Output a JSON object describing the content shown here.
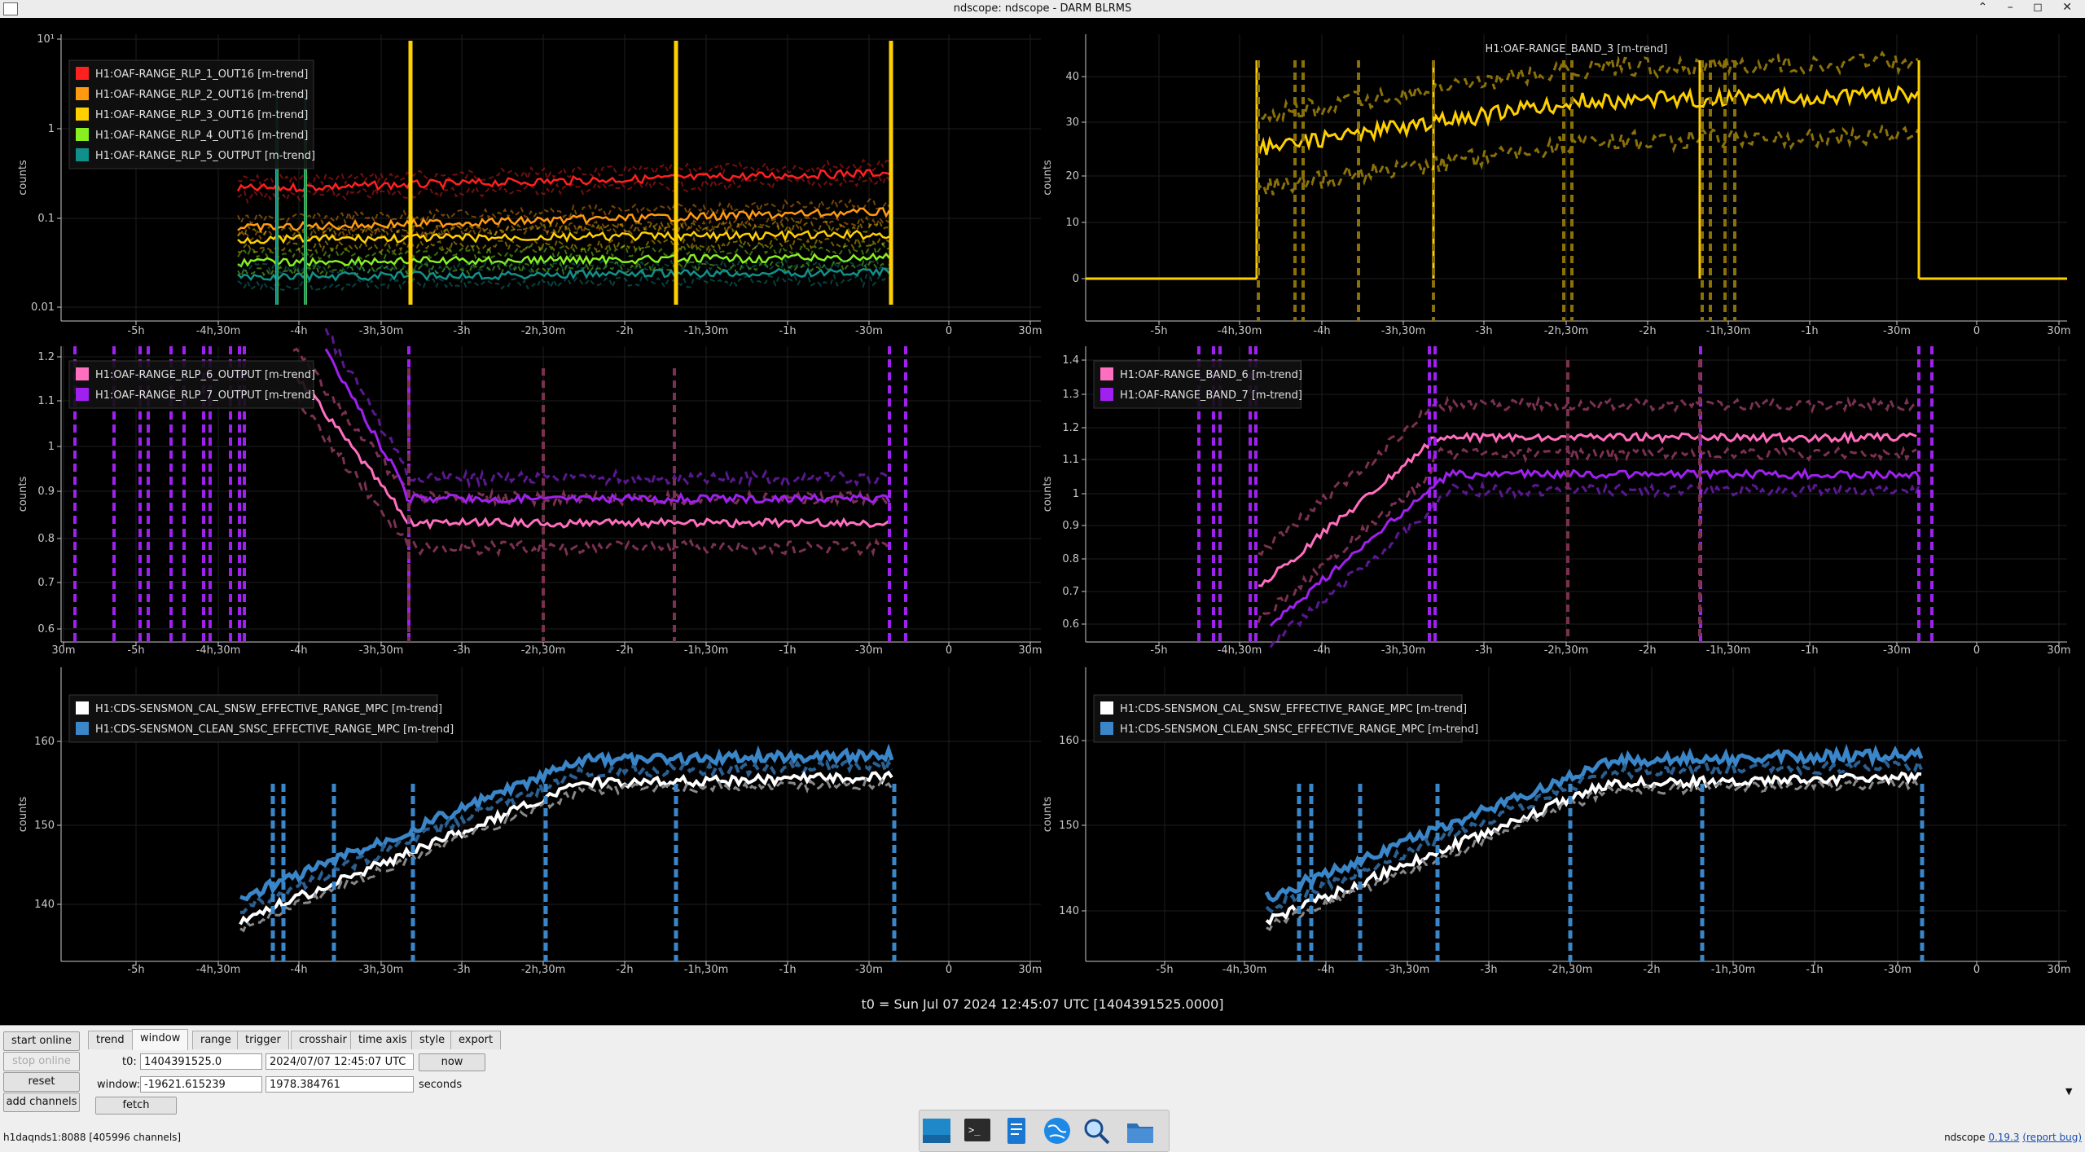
{
  "window": {
    "title": "ndscope: ndscope - DARM BLRMS",
    "controls": [
      "⌃",
      "–",
      "◻",
      "✕"
    ]
  },
  "t0_label": "t0 = Sun Jul 07 2024 12:45:07 UTC [1404391525.0000]",
  "colors": {
    "red": "#ff2020",
    "orange": "#ff9a10",
    "gold": "#ffd000",
    "green": "#88f020",
    "teal": "#10908a",
    "pink": "#ff6fbf",
    "purple": "#a020f0",
    "white": "#ffffff",
    "blue": "#3a86c8",
    "axis": "#c8c8c8",
    "background": "#000000"
  },
  "panels": [
    {
      "id": "top-left",
      "title": "",
      "ylabel": "counts",
      "log": true,
      "yticks": [
        "10¹",
        "1",
        "0.1",
        "0.01"
      ],
      "xticks": [
        "-5h",
        "-4h,30m",
        "-4h",
        "-3h,30m",
        "-3h",
        "-2h,30m",
        "-2h",
        "-1h,30m",
        "-1h",
        "-30m",
        "0",
        "30m"
      ],
      "legend": [
        {
          "label": "H1:OAF-RANGE_RLP_1_OUT16 [m-trend]",
          "color": "#ff2020"
        },
        {
          "label": "H1:OAF-RANGE_RLP_2_OUT16 [m-trend]",
          "color": "#ff9a10"
        },
        {
          "label": "H1:OAF-RANGE_RLP_3_OUT16 [m-trend]",
          "color": "#ffd000"
        },
        {
          "label": "H1:OAF-RANGE_RLP_4_OUT16 [m-trend]",
          "color": "#88f020"
        },
        {
          "label": "H1:OAF-RANGE_RLP_5_OUTPUT [m-trend]",
          "color": "#10908a"
        }
      ]
    },
    {
      "id": "top-right",
      "title": "H1:OAF-RANGE_BAND_3 [m-trend]",
      "ylabel": "counts",
      "log": false,
      "yticks": [
        "40",
        "30",
        "20",
        "10",
        "0"
      ],
      "xticks": [
        "-5h",
        "-4h,30m",
        "-4h",
        "-3h,30m",
        "-3h",
        "-2h,30m",
        "-2h",
        "-1h,30m",
        "-1h",
        "-30m",
        "0",
        "30m"
      ],
      "legend": []
    },
    {
      "id": "mid-left",
      "title": "",
      "ylabel": "counts",
      "log": false,
      "yticks": [
        "1.2",
        "1.1",
        "1",
        "0.9",
        "0.8",
        "0.7",
        "0.6"
      ],
      "xticks": [
        "30m",
        "-5h",
        "-4h,30m",
        "-4h",
        "-3h,30m",
        "-3h",
        "-2h,30m",
        "-2h",
        "-1h,30m",
        "-1h",
        "-30m",
        "0",
        "30m"
      ],
      "legend": [
        {
          "label": "H1:OAF-RANGE_RLP_6_OUTPUT [m-trend]",
          "color": "#ff6fbf"
        },
        {
          "label": "H1:OAF-RANGE_RLP_7_OUTPUT [m-trend]",
          "color": "#a020f0"
        }
      ]
    },
    {
      "id": "mid-right",
      "title": "",
      "ylabel": "counts",
      "log": false,
      "yticks": [
        "1.4",
        "1.3",
        "1.2",
        "1.1",
        "1",
        "0.9",
        "0.8",
        "0.7",
        "0.6"
      ],
      "xticks": [
        "-5h",
        "-4h,30m",
        "-4h",
        "-3h,30m",
        "-3h",
        "-2h,30m",
        "-2h",
        "-1h,30m",
        "-1h",
        "-30m",
        "0",
        "30m"
      ],
      "legend": [
        {
          "label": "H1:OAF-RANGE_BAND_6 [m-trend]",
          "color": "#ff6fbf"
        },
        {
          "label": "H1:OAF-RANGE_BAND_7 [m-trend]",
          "color": "#a020f0"
        }
      ]
    },
    {
      "id": "bottom-left",
      "title": "",
      "ylabel": "counts",
      "log": false,
      "yticks": [
        "160",
        "150",
        "140"
      ],
      "xticks": [
        "-5h",
        "-4h,30m",
        "-4h",
        "-3h,30m",
        "-3h",
        "-2h,30m",
        "-2h",
        "-1h,30m",
        "-1h",
        "-30m",
        "0",
        "30m"
      ],
      "legend": [
        {
          "label": "H1:CDS-SENSMON_CAL_SNSW_EFFECTIVE_RANGE_MPC [m-trend]",
          "color": "#ffffff"
        },
        {
          "label": "H1:CDS-SENSMON_CLEAN_SNSC_EFFECTIVE_RANGE_MPC [m-trend]",
          "color": "#3a86c8"
        }
      ]
    },
    {
      "id": "bottom-right",
      "title": "",
      "ylabel": "counts",
      "log": false,
      "yticks": [
        "160",
        "150",
        "140"
      ],
      "xticks": [
        "-5h",
        "-4h,30m",
        "-4h",
        "-3h,30m",
        "-3h",
        "-2h,30m",
        "-2h",
        "-1h,30m",
        "-1h",
        "-30m",
        "0",
        "30m"
      ],
      "legend": [
        {
          "label": "H1:CDS-SENSMON_CAL_SNSW_EFFECTIVE_RANGE_MPC [m-trend]",
          "color": "#ffffff"
        },
        {
          "label": "H1:CDS-SENSMON_CLEAN_SNSC_EFFECTIVE_RANGE_MPC [m-trend]",
          "color": "#3a86c8"
        }
      ]
    }
  ],
  "controls": {
    "left_buttons": {
      "start_online": "start online",
      "stop_online": "stop online",
      "reset": "reset",
      "add_channels": "add channels"
    },
    "tabs": [
      "trend",
      "window",
      "range",
      "trigger",
      "crosshair",
      "time axis",
      "style",
      "export"
    ],
    "active_tab": "window",
    "t0_label": "t0:",
    "t0_gps": "1404391525.0",
    "t0_utc": "2024/07/07 12:45:07 UTC",
    "now_button": "now",
    "window_label": "window:",
    "window_start": "-19621.615239",
    "window_end": "1978.384761",
    "seconds_label": "seconds",
    "fetch_button": "fetch",
    "collapse_arrow": "▼"
  },
  "status": {
    "server": "h1daqnds1:8088",
    "channels": "[405996 channels]"
  },
  "version": {
    "app": "ndscope",
    "version": "0.19.3",
    "report": "(report bug)"
  },
  "taskbar": {
    "icons": [
      "desktop-icon",
      "terminal-icon",
      "text-editor-icon",
      "browser-icon",
      "search-icon",
      "folder-icon"
    ]
  }
}
